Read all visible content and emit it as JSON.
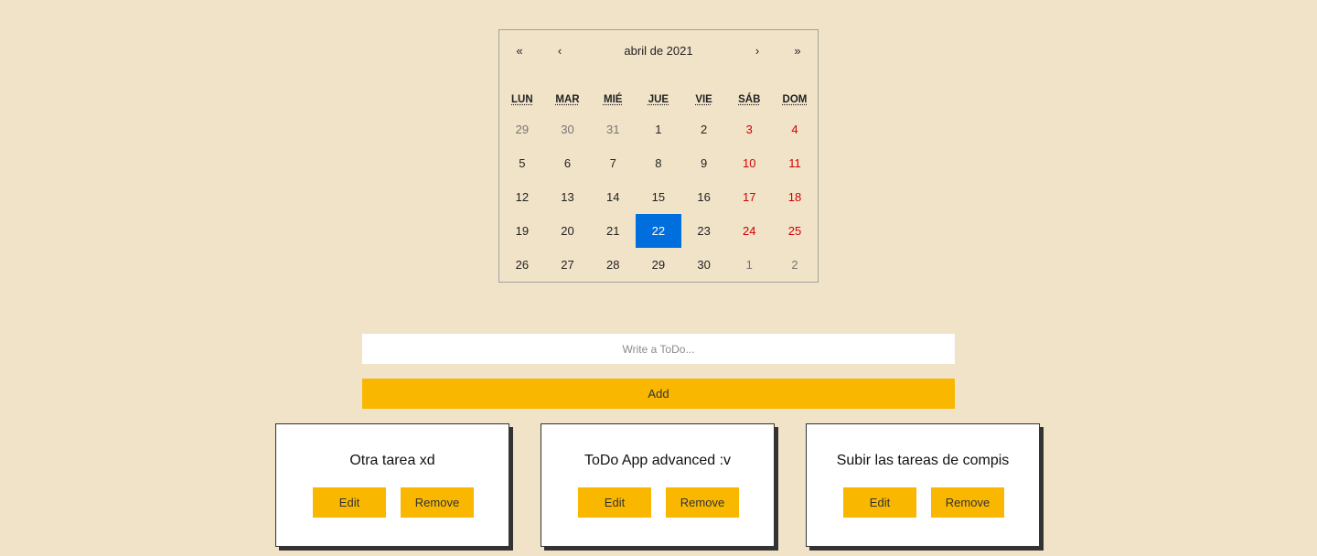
{
  "calendar": {
    "nav": {
      "prev2": "«",
      "prev": "‹",
      "label": "abril de 2021",
      "next": "›",
      "next2": "»"
    },
    "weekdays": [
      "LUN",
      "MAR",
      "MIÉ",
      "JUE",
      "VIE",
      "SÁB",
      "DOM"
    ],
    "days": [
      {
        "label": "29",
        "type": "neighbor"
      },
      {
        "label": "30",
        "type": "neighbor"
      },
      {
        "label": "31",
        "type": "neighbor"
      },
      {
        "label": "1",
        "type": "normal"
      },
      {
        "label": "2",
        "type": "normal"
      },
      {
        "label": "3",
        "type": "weekend"
      },
      {
        "label": "4",
        "type": "weekend"
      },
      {
        "label": "5",
        "type": "normal"
      },
      {
        "label": "6",
        "type": "normal"
      },
      {
        "label": "7",
        "type": "normal"
      },
      {
        "label": "8",
        "type": "normal"
      },
      {
        "label": "9",
        "type": "normal"
      },
      {
        "label": "10",
        "type": "weekend"
      },
      {
        "label": "11",
        "type": "weekend"
      },
      {
        "label": "12",
        "type": "normal"
      },
      {
        "label": "13",
        "type": "normal"
      },
      {
        "label": "14",
        "type": "normal"
      },
      {
        "label": "15",
        "type": "normal"
      },
      {
        "label": "16",
        "type": "normal"
      },
      {
        "label": "17",
        "type": "weekend"
      },
      {
        "label": "18",
        "type": "weekend"
      },
      {
        "label": "19",
        "type": "normal"
      },
      {
        "label": "20",
        "type": "normal"
      },
      {
        "label": "21",
        "type": "normal"
      },
      {
        "label": "22",
        "type": "active"
      },
      {
        "label": "23",
        "type": "normal"
      },
      {
        "label": "24",
        "type": "weekend"
      },
      {
        "label": "25",
        "type": "weekend"
      },
      {
        "label": "26",
        "type": "normal"
      },
      {
        "label": "27",
        "type": "normal"
      },
      {
        "label": "28",
        "type": "normal"
      },
      {
        "label": "29",
        "type": "normal"
      },
      {
        "label": "30",
        "type": "normal"
      },
      {
        "label": "1",
        "type": "neighbor"
      },
      {
        "label": "2",
        "type": "neighbor"
      }
    ]
  },
  "todo_form": {
    "input_value": "",
    "input_placeholder": "Write a ToDo...",
    "add_label": "Add"
  },
  "todos": [
    {
      "title": "Otra tarea xd",
      "edit_label": "Edit",
      "remove_label": "Remove"
    },
    {
      "title": "ToDo App advanced :v",
      "edit_label": "Edit",
      "remove_label": "Remove"
    },
    {
      "title": "Subir las tareas de compis",
      "edit_label": "Edit",
      "remove_label": "Remove"
    }
  ],
  "colors": {
    "background": "#f1e3c8",
    "accent": "#f9b700",
    "selected_day": "#006edc",
    "weekend": "#d10000",
    "neighbor_day": "#757575"
  }
}
